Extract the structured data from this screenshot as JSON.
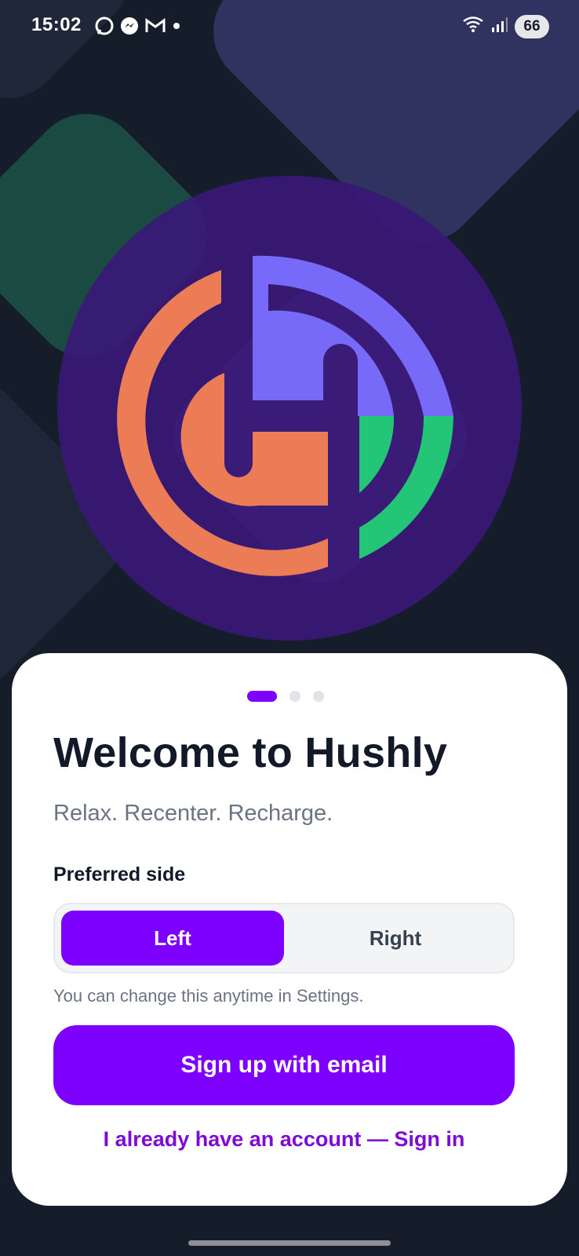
{
  "status_bar": {
    "time": "15:02",
    "notification_icons": [
      "whatsapp-icon",
      "messenger-icon",
      "gmail-icon",
      "dot-icon"
    ],
    "battery_level": "66",
    "network_icons": [
      "wifi-icon",
      "signal-icon"
    ]
  },
  "hero": {
    "logo_icon": "hushly-logo-icon",
    "colors": {
      "circle": "#3a1877",
      "orange": "#ec7c55",
      "purple": "#776af9",
      "green": "#23c576"
    }
  },
  "onboarding": {
    "page_indicator": {
      "total": 3,
      "active": 1
    },
    "title": "Welcome to Hushly",
    "subtitle": "Relax. Recenter. Recharge.",
    "preferred_side": {
      "label": "Preferred side",
      "options": [
        "Left",
        "Right"
      ],
      "selected": "Left"
    },
    "helper_text": "You can change this anytime in Settings.",
    "primary_button": "Sign up with email",
    "signin_link": "I already have an account — Sign in"
  },
  "colors": {
    "accent": "#7d00fe",
    "background": "#161d2a",
    "card": "#ffffff"
  }
}
